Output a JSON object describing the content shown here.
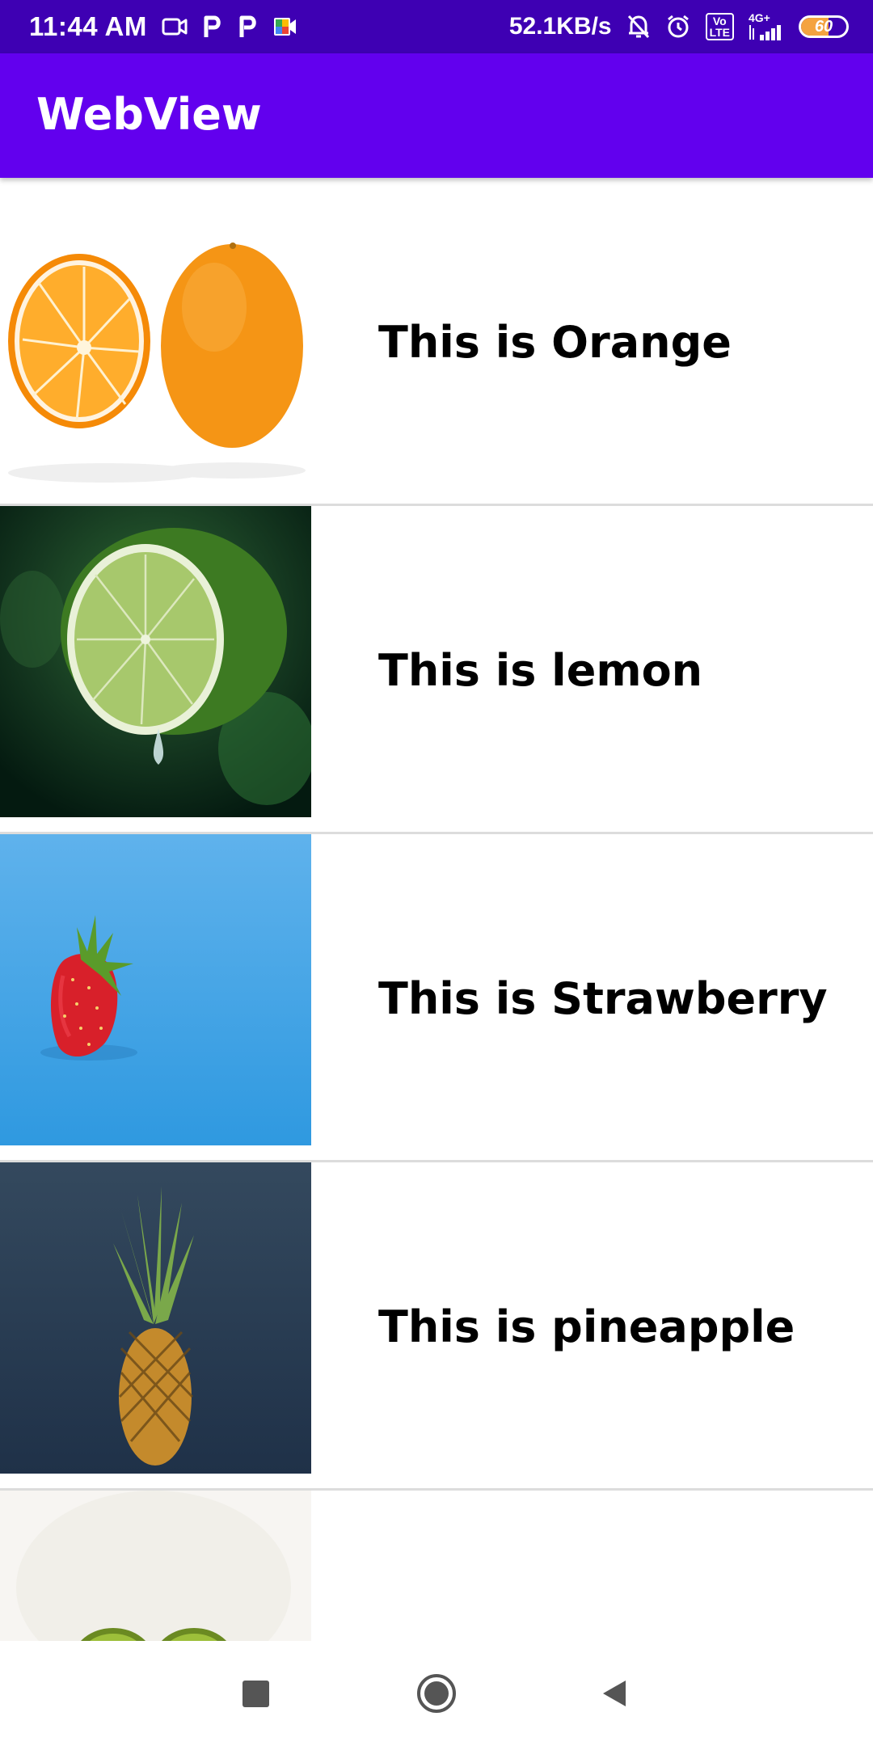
{
  "status_bar": {
    "time": "11:44 AM",
    "net_speed": "52.1KB/s",
    "volte_label": "Vo\nLTE",
    "network_label": "4G+",
    "battery_level": "60",
    "battery_fraction": 0.6,
    "left_icons": [
      "video-camera-icon",
      "p-app-icon",
      "p-app-icon",
      "meet-icon"
    ],
    "right_icons": [
      "bell-off-icon",
      "alarm-icon",
      "volte-icon",
      "signal-icon",
      "battery-icon"
    ]
  },
  "app_bar": {
    "title": "WebView"
  },
  "list": {
    "items": [
      {
        "label": "This is Orange",
        "image": "orange-image"
      },
      {
        "label": "This is lemon",
        "image": "lemon-image"
      },
      {
        "label": "This is Strawberry",
        "image": "strawberry-image"
      },
      {
        "label": "This is pineapple",
        "image": "pineapple-image"
      },
      {
        "label": "",
        "image": "kiwi-image"
      }
    ]
  },
  "nav_bar": {
    "buttons": [
      "recents-button",
      "home-button",
      "back-button"
    ]
  },
  "colors": {
    "status_bar": "#3e00b3",
    "app_bar": "#6200ee",
    "divider": "#dcdcdc",
    "text": "#000000"
  }
}
